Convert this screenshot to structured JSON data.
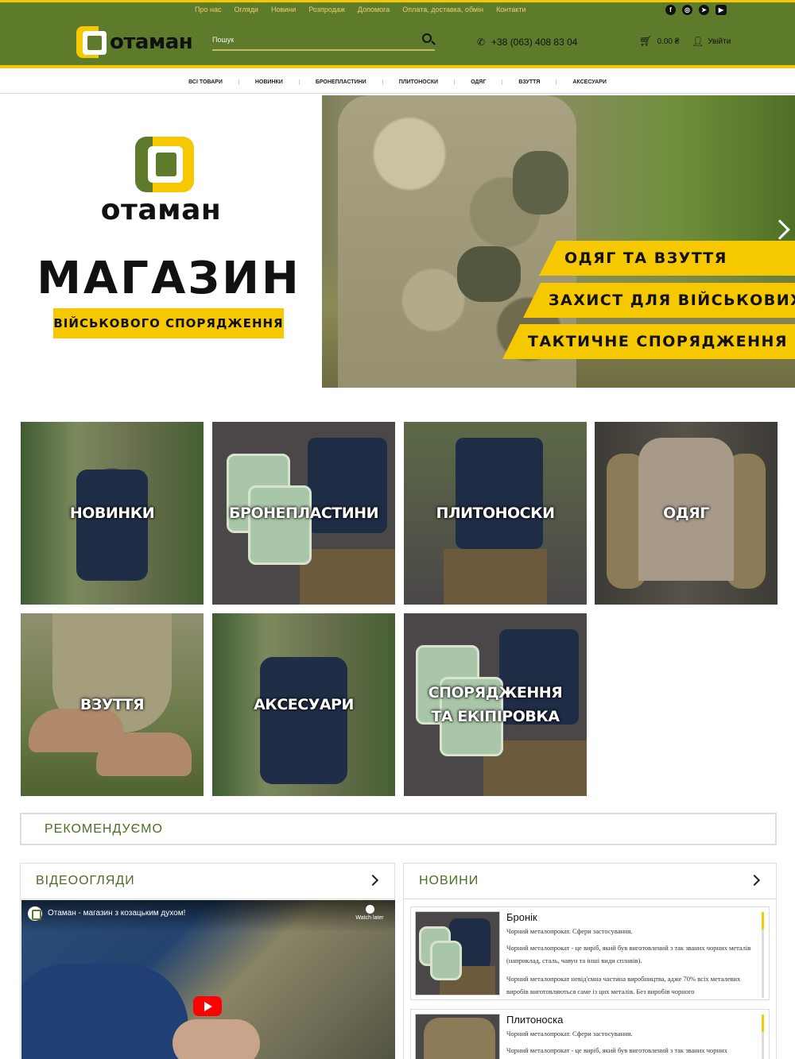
{
  "topbar": {
    "links": [
      "Про нас",
      "Огляди",
      "Новини",
      "Розпродаж",
      "Допомога",
      "Оплата, доставка, обмін",
      "Контакти"
    ],
    "social": [
      "facebook-icon",
      "instagram-icon",
      "telegram-icon",
      "youtube-icon"
    ]
  },
  "header": {
    "logo_text": "отаман",
    "search_placeholder": "Пошук",
    "phone": "+38 (063) 408 83 04",
    "cart_total": "0.00 ₴",
    "login": "Увійти"
  },
  "catnav": [
    "ВСІ ТОВАРИ",
    "НОВИНКИ",
    "БРОНЕПЛАСТИНИ",
    "ПЛИТОНОСКИ",
    "ОДЯГ",
    "ВЗУТТЯ",
    "АКСЕСУАРИ"
  ],
  "hero": {
    "brand": "отаман",
    "headline": "МАГАЗИН",
    "ribbon": "ВІЙСЬКОВОГО СПОРЯДЖЕННЯ",
    "tags": [
      "ОДЯГ ТА ВЗУТТЯ",
      "ЗАХИСТ ДЛЯ ВІЙСЬКОВИХ",
      "ТАКТИЧНЕ СПОРЯДЖЕННЯ"
    ]
  },
  "tiles": [
    {
      "label": "НОВИНКИ"
    },
    {
      "label": "БРОНЕПЛАСТИНИ"
    },
    {
      "label": "ПЛИТОНОСКИ"
    },
    {
      "label": "ОДЯГ"
    },
    {
      "label": "ВЗУТТЯ"
    },
    {
      "label": "АКСЕСУАРИ"
    },
    {
      "label_line1": "СПОРЯДЖЕННЯ",
      "label_line2": "ТА ЕКІПІРОВКА"
    }
  ],
  "recommend": {
    "title": "РЕКОМЕНДУЄМО"
  },
  "videos": {
    "title": "ВІДЕООГЛЯДИ",
    "video_title": "Отаман - магазин з козацьким духом!",
    "watch_later": "Watch later"
  },
  "news": {
    "title": "НОВИНИ",
    "items": [
      {
        "title": "Бронік",
        "p1": "Чорний металопрокат. Сфери застосування.",
        "p2": "Чорний металопрокат - це виріб, який був виготовлений з так званих чорних металів (наприклад, сталь, чавун та інші види сплавів).",
        "p3": "Чорний металопрокат невід'ємна частина виробництва, адже 70% всіх металевих виробів виготовляються саме із цих металів. Без виробів чорного"
      },
      {
        "title": "Плитоноска",
        "p1": "Чорний металопрокат. Сфери застосування.",
        "p2": "Чорний металопрокат - це виріб, який був виготовлений з так званих чорних"
      }
    ]
  },
  "colors": {
    "brand_green": "#5e7a2b",
    "brand_yellow": "#f5c800"
  }
}
